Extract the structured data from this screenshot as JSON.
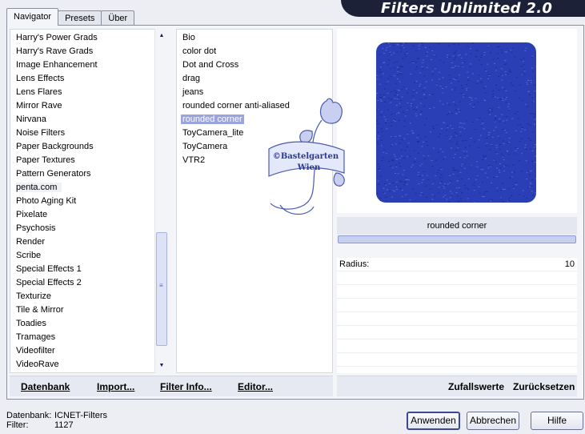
{
  "tabs": [
    {
      "label": "Navigator"
    },
    {
      "label": "Presets"
    },
    {
      "label": "Über"
    }
  ],
  "app_title": "Filters Unlimited 2.0",
  "categories": [
    "Harry's Power Grads",
    "Harry's Rave Grads",
    "Image Enhancement",
    "Lens Effects",
    "Lens Flares",
    "Mirror Rave",
    "Nirvana",
    "Noise Filters",
    "Paper Backgrounds",
    "Paper Textures",
    "Pattern Generators",
    "penta.com",
    "Photo Aging Kit",
    "Pixelate",
    "Psychosis",
    "Render",
    "Scribe",
    "Special Effects 1",
    "Special Effects 2",
    "Texturize",
    "Tile & Mirror",
    "Toadies",
    "Tramages",
    "Videofilter",
    "VideoRave"
  ],
  "selected_category": "penta.com",
  "filters": [
    "Bio",
    "color dot",
    "Dot and Cross",
    "drag",
    "jeans",
    "rounded corner anti-aliased",
    "rounded corner",
    "ToyCamera_lite",
    "ToyCamera",
    "VTR2"
  ],
  "selected_filter": "rounded corner",
  "left_actions": {
    "datenbank": "Datenbank",
    "import": "Import...",
    "filter_info": "Filter Info...",
    "editor": "Editor..."
  },
  "filter_title": "rounded corner",
  "params": [
    {
      "label": "Radius:",
      "value": "10"
    }
  ],
  "right_actions": {
    "zufallswerte": "Zufallswerte",
    "zuruecksetzen": "Zurücksetzen"
  },
  "status": {
    "db_label": "Datenbank:",
    "db_value": "ICNET-Filters",
    "filter_label": "Filter:",
    "filter_value": "1127"
  },
  "buttons": {
    "apply": "Anwenden",
    "cancel": "Abbrechen",
    "help": "Hilfe"
  },
  "watermark_text": [
    "©Bastelgarten",
    "Wien"
  ],
  "colors": {
    "selection": "#9aa5e0",
    "preview": "#2a3fb5",
    "title_bar": "#1c2138"
  }
}
